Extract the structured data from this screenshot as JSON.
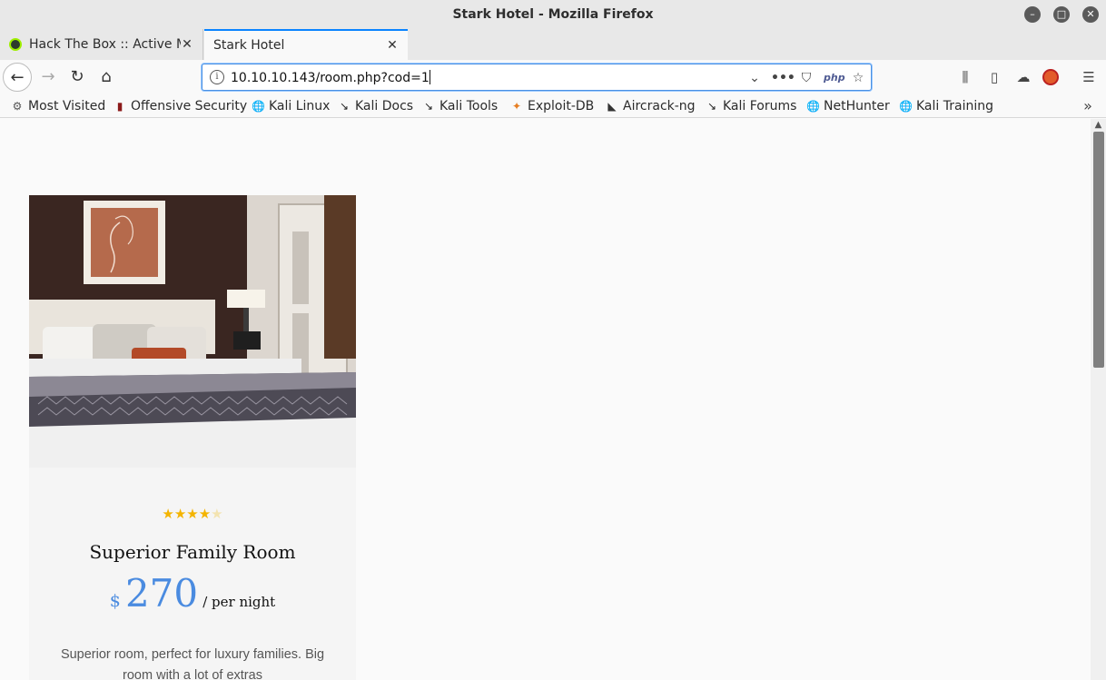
{
  "window": {
    "title": "Stark Hotel - Mozilla Firefox",
    "minimize": "–",
    "maximize": "□",
    "close": "✕"
  },
  "tabs": [
    {
      "label": "Hack The Box :: Active Ma",
      "close": "✕"
    },
    {
      "label": "Stark Hotel",
      "close": "✕"
    }
  ],
  "newtab": "+",
  "nav": {
    "back": "←",
    "forward": "→",
    "reload": "↻",
    "home": "⌂"
  },
  "urlbar": {
    "url": "10.10.10.143/room.php?cod=1",
    "info": "i",
    "dropdown": "⌄",
    "more": "•••",
    "pocket": "⛉",
    "php": "php",
    "star": "☆"
  },
  "toolbar_right": {
    "library": "⫼",
    "sidebar": "▯",
    "sync": "☁",
    "addon": "",
    "menu": "☰"
  },
  "bookmarks": [
    {
      "icon": "gear-icon",
      "glyph": "⚙",
      "label": "Most Visited"
    },
    {
      "icon": "offsec-icon",
      "glyph": "▮",
      "label": "Offensive Security"
    },
    {
      "icon": "globe-icon",
      "glyph": "🌐",
      "label": "Kali Linux"
    },
    {
      "icon": "kali-icon",
      "glyph": "↘",
      "label": "Kali Docs"
    },
    {
      "icon": "kali-icon",
      "glyph": "↘",
      "label": "Kali Tools"
    },
    {
      "icon": "exploitdb-icon",
      "glyph": "✦",
      "label": "Exploit-DB"
    },
    {
      "icon": "aircrack-icon",
      "glyph": "◣",
      "label": "Aircrack-ng"
    },
    {
      "icon": "kali-icon",
      "glyph": "↘",
      "label": "Kali Forums"
    },
    {
      "icon": "globe-icon",
      "glyph": "🌐",
      "label": "NetHunter"
    },
    {
      "icon": "globe-icon",
      "glyph": "🌐",
      "label": "Kali Training"
    }
  ],
  "bookmarks_overflow": "»",
  "room": {
    "rating": 4,
    "rating_max": 5,
    "name": "Superior Family Room",
    "currency": "$",
    "price": "270",
    "per": "/ per night",
    "description": "Superior room, perfect for luxury families. Big room with a lot of extras"
  },
  "colors": {
    "accent": "#4a8be0",
    "star": "#f4b400",
    "tab_highlight": "#0a84ff"
  }
}
